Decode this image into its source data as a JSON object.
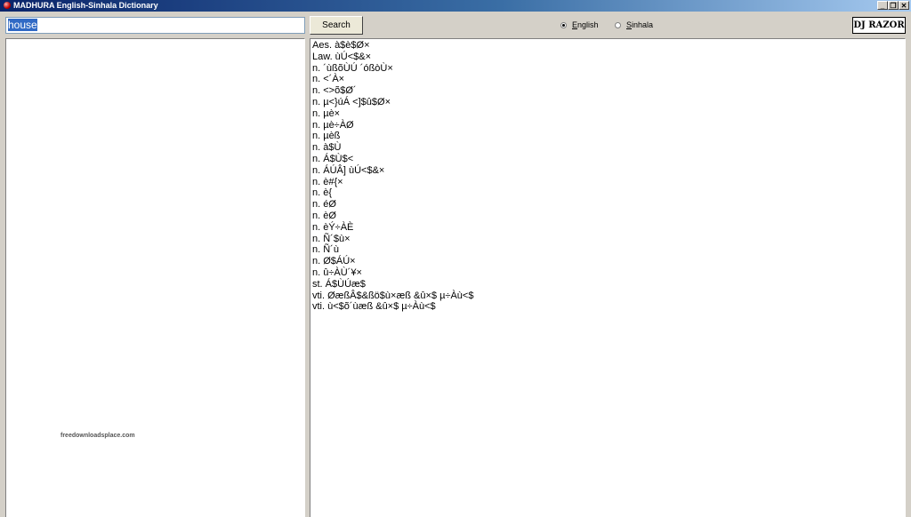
{
  "window": {
    "title": "MADHURA English-Sinhala Dictionary",
    "controls": {
      "minimize": "_",
      "restore": "❐",
      "close": "✕"
    }
  },
  "search": {
    "query": "house",
    "button_label": "Search"
  },
  "language": {
    "options": [
      {
        "mnemonic": "E",
        "rest": "nglish",
        "selected": true
      },
      {
        "mnemonic": "S",
        "rest": "inhala",
        "selected": false
      }
    ]
  },
  "brand": {
    "label": "DJ RAZOR"
  },
  "watermark": "freedownloadsplace.com",
  "definitions": [
    "Aes. à$è$Ø×",
    "Law. ùÚ<$&×",
    "n. ´ùßõÙÚ ´óßòÙ×",
    "n. <´À×",
    "n. <>õ$Ø´",
    "n. µ<}úÁ <]$û$Ø×",
    "n. µè×",
    "n. µè÷ÀØ",
    "n. µèß",
    "n. à$Ù",
    "n. Á$Ù$<",
    "n. ÁÚÂ] ùÚ<$&×",
    "n. è#{×",
    "n. è{",
    "n. éØ",
    "n. èØ",
    "n. èÝ÷ÀÈ",
    "n. Ñ´$ù×",
    "n. Ñ´ù",
    "n. Ø$ÁÚ×",
    "n. û÷ÀÙ´¥×",
    "st. Á$ÙÚæ$",
    "vti. ØæßÂ$&ßö$ù×æß &û×$ µ÷Àù<$",
    "vti. ù<$õ´ùæß &û×$ µ÷Àù<$"
  ]
}
